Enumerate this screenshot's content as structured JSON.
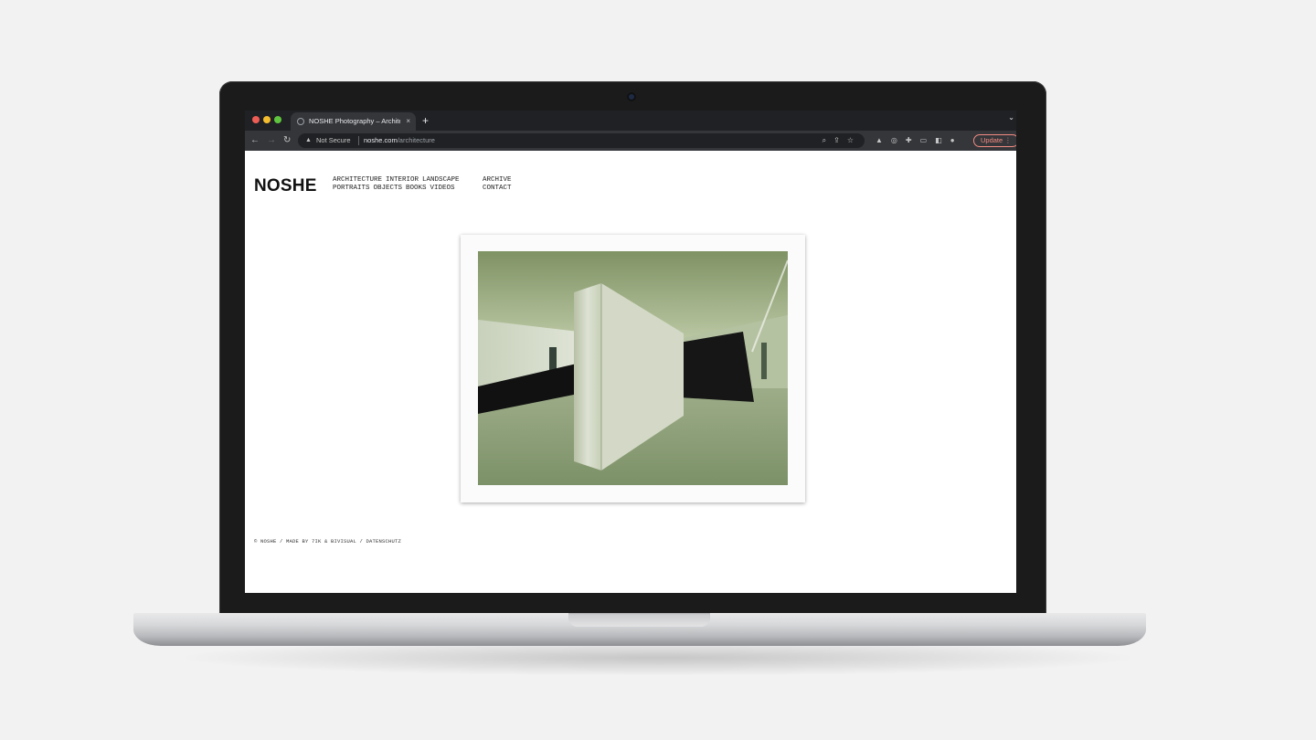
{
  "browser": {
    "tab_title": "NOSHE Photography – Architec",
    "tab_close": "×",
    "new_tab": "+",
    "tab_menu": "⌄",
    "security_label": "Not Secure",
    "url_host": "noshe.com",
    "url_path": "/architecture",
    "update_label": "Update ⋮",
    "icons": [
      "back-arrow-icon",
      "forward-arrow-icon",
      "reload-icon",
      "warning-icon",
      "zoom-icon",
      "share-icon",
      "star-icon",
      "drive-icon",
      "extension-icon",
      "puzzle-icon",
      "cast-icon",
      "sidepanel-icon",
      "profile-icon"
    ]
  },
  "site": {
    "logo": "NOSHE",
    "nav_row1": [
      "ARCHITECTURE",
      "INTERIOR",
      "LANDSCAPE"
    ],
    "nav_row2": [
      "PORTRAITS",
      "OBJECTS",
      "BOOKS",
      "VIDEOS"
    ],
    "nav_col2": [
      "ARCHIVE",
      "CONTACT"
    ],
    "footer": "© NOSHE / MADE BY 7IK & BIVISUAL / DATENSCHUTZ"
  },
  "colors": {
    "accent_update": "#f28b82",
    "chrome_dark": "#202124",
    "chrome_toolbar": "#35363a"
  }
}
